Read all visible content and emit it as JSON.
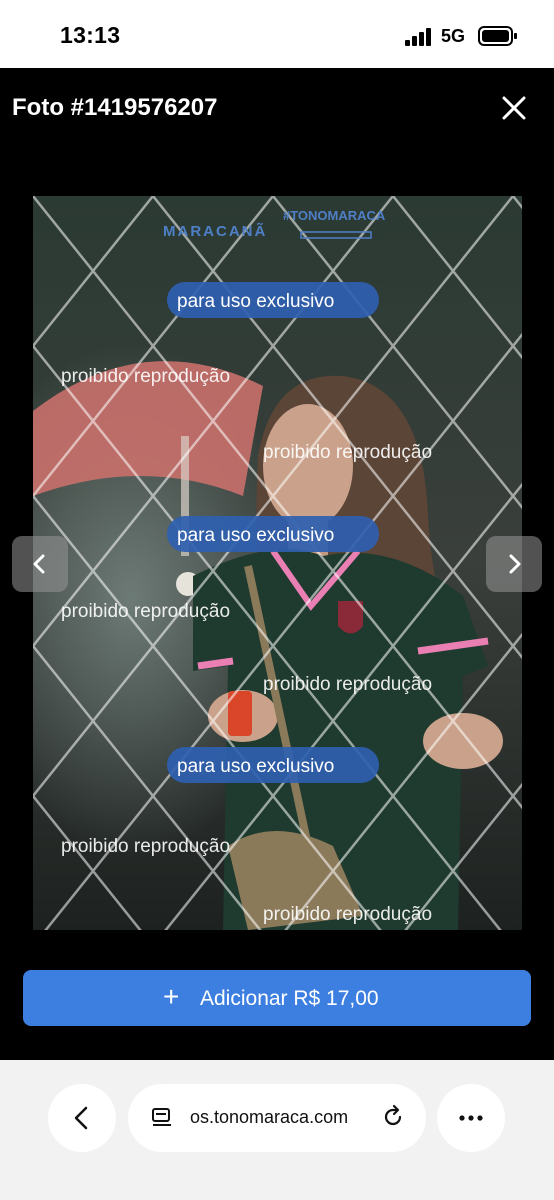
{
  "status_bar": {
    "time": "13:13",
    "network": "5G"
  },
  "modal": {
    "title": "Foto #1419576207",
    "watermarks": {
      "top_logos": [
        "MARACANÃ",
        "#TONOMARACA"
      ],
      "exclusive": "para uso exclusivo",
      "prohibited": "proibido reprodução"
    },
    "add_button": {
      "icon": "plus-icon",
      "label": "Adicionar R$ 17,00"
    }
  },
  "browser_bar": {
    "url": "os.tonomaraca.com"
  },
  "colors": {
    "accent": "#3d7fe0",
    "badge": "#2f5fb0",
    "modal_bg": "#000000"
  }
}
